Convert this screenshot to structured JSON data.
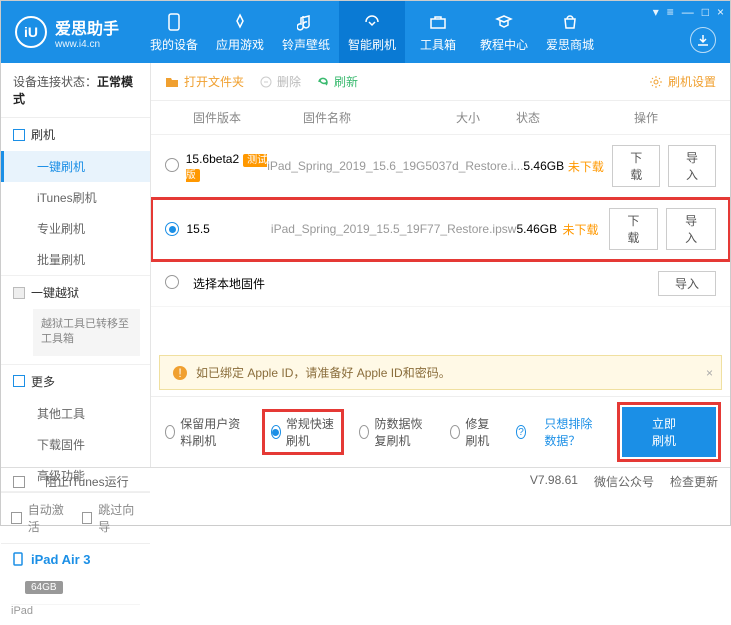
{
  "app": {
    "name_cn": "爱思助手",
    "url": "www.i4.cn",
    "logo": "iU"
  },
  "win": {
    "b1": "▾",
    "b2": "≡",
    "b3": "—",
    "b4": "□",
    "b5": "×"
  },
  "nav": [
    {
      "label": "我的设备"
    },
    {
      "label": "应用游戏"
    },
    {
      "label": "铃声壁纸"
    },
    {
      "label": "智能刷机"
    },
    {
      "label": "工具箱"
    },
    {
      "label": "教程中心"
    },
    {
      "label": "爱思商城"
    }
  ],
  "status": {
    "prefix": "设备连接状态：",
    "value": "正常模式"
  },
  "sidebar": {
    "g1": {
      "title": "刷机",
      "items": [
        "一键刷机",
        "iTunes刷机",
        "专业刷机",
        "批量刷机"
      ]
    },
    "g2": {
      "title": "一键越狱",
      "migrate": "越狱工具已转移至工具箱"
    },
    "g3": {
      "title": "更多",
      "items": [
        "其他工具",
        "下载固件",
        "高级功能"
      ]
    }
  },
  "auto": {
    "chk": "自动激活",
    "skip": "跳过向导"
  },
  "device": {
    "name": "iPad Air 3",
    "storage": "64GB",
    "type": "iPad"
  },
  "toolbar": {
    "open": "打开文件夹",
    "del": "删除",
    "refresh": "刷新",
    "settings": "刷机设置"
  },
  "thead": {
    "ver": "固件版本",
    "name": "固件名称",
    "size": "大小",
    "status": "状态",
    "ops": "操作"
  },
  "rows": [
    {
      "ver": "15.6beta2",
      "tag": "测试版",
      "name": "iPad_Spring_2019_15.6_19G5037d_Restore.i...",
      "size": "5.46GB",
      "status": "未下载",
      "b1": "下载",
      "b2": "导入",
      "sel": false
    },
    {
      "ver": "15.5",
      "tag": "",
      "name": "iPad_Spring_2019_15.5_19F77_Restore.ipsw",
      "size": "5.46GB",
      "status": "未下载",
      "b1": "下载",
      "b2": "导入",
      "sel": true
    },
    {
      "ver": "选择本地固件",
      "tag": "",
      "name": "",
      "size": "",
      "status": "",
      "b1": "",
      "b2": "导入",
      "sel": false
    }
  ],
  "banner": "如已绑定 Apple ID，请准备好 Apple ID和密码。",
  "modes": {
    "m1": "保留用户资料刷机",
    "m2": "常规快速刷机",
    "m3": "防数据恢复刷机",
    "m4": "修复刷机",
    "link": "只想排除数据？",
    "run": "立即刷机"
  },
  "footer": {
    "block": "阻止iTunes运行",
    "ver": "V7.98.61",
    "wx": "微信公众号",
    "upd": "检查更新"
  }
}
